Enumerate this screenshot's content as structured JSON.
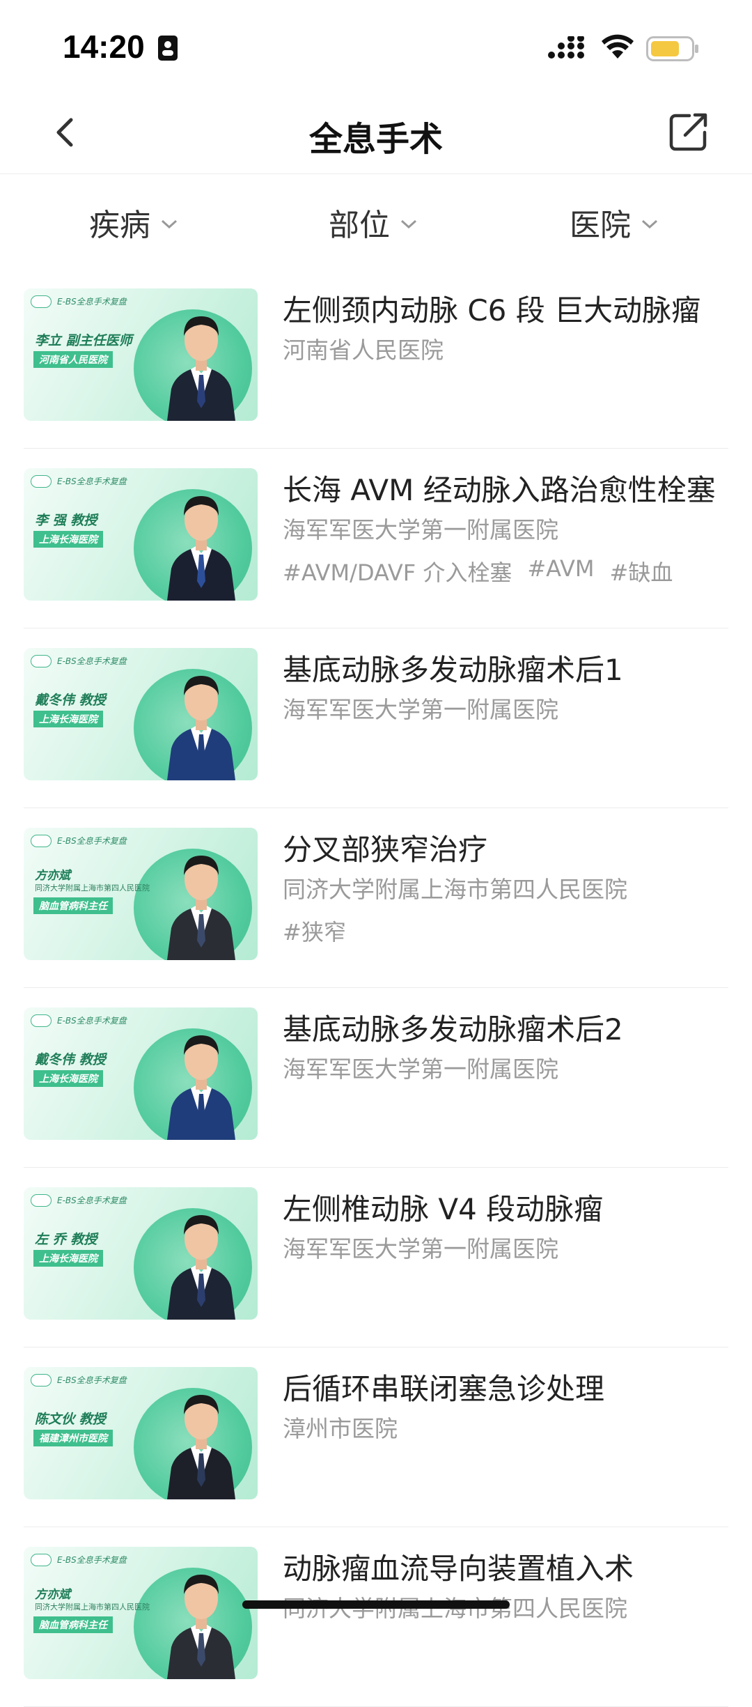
{
  "status_bar": {
    "time": "14:20",
    "icons": [
      "id-card-icon",
      "cellular-signal-icon",
      "wifi-icon",
      "battery-icon"
    ],
    "battery_color": "#f5c842"
  },
  "nav": {
    "title": "全息手术",
    "back_icon": "chevron-left-icon",
    "share_icon": "share-icon"
  },
  "filters": [
    {
      "label": "疾病",
      "icon": "chevron-down-icon"
    },
    {
      "label": "部位",
      "icon": "chevron-down-icon"
    },
    {
      "label": "医院",
      "icon": "chevron-down-icon"
    }
  ],
  "thumbnail_brand": "E-BS全息手术复盘",
  "items": [
    {
      "title": "左侧颈内动脉 C6 段 巨大动脉瘤",
      "hospital": "河南省人民医院",
      "tags": [],
      "thumb": {
        "doctor": "李立  副主任医师",
        "sub": "",
        "badge": "河南省人民医院",
        "suit": "#1d2433",
        "tie": "#2a3f7a"
      }
    },
    {
      "title": "长海 AVM 经动脉入路治愈性栓塞",
      "hospital": "海军军医大学第一附属医院",
      "tags": [
        "#AVM/DAVF 介入栓塞",
        "#AVM",
        "#缺血"
      ],
      "thumb": {
        "doctor": "李  强  教授",
        "sub": "",
        "badge": "上海长海医院",
        "suit": "#1b2030",
        "tie": "#2d4f9a"
      }
    },
    {
      "title": "基底动脉多发动脉瘤术后1",
      "hospital": "海军军医大学第一附属医院",
      "tags": [],
      "thumb": {
        "doctor": "戴冬伟  教授",
        "sub": "",
        "badge": "上海长海医院",
        "suit": "#1f3d7a",
        "tie": "#1f3d7a"
      }
    },
    {
      "title": "分叉部狭窄治疗",
      "hospital": "同济大学附属上海市第四人民医院",
      "tags": [
        "#狭窄"
      ],
      "thumb": {
        "doctor": "方亦斌",
        "sub": "同济大学附属上海市第四人民医院",
        "badge": "脑血管病科主任",
        "suit": "#2a2d34",
        "tie": "#3b4a6a"
      }
    },
    {
      "title": "基底动脉多发动脉瘤术后2",
      "hospital": "海军军医大学第一附属医院",
      "tags": [],
      "thumb": {
        "doctor": "戴冬伟  教授",
        "sub": "",
        "badge": "上海长海医院",
        "suit": "#1f3d7a",
        "tie": "#1f3d7a"
      }
    },
    {
      "title": "左侧椎动脉 V4 段动脉瘤",
      "hospital": "海军军医大学第一附属医院",
      "tags": [],
      "thumb": {
        "doctor": "左  乔  教授",
        "sub": "",
        "badge": "上海长海医院",
        "suit": "#1d2433",
        "tie": "#2c3e6e"
      }
    },
    {
      "title": "后循环串联闭塞急诊处理",
      "hospital": "漳州市医院",
      "tags": [],
      "thumb": {
        "doctor": "陈文伙  教授",
        "sub": "",
        "badge": "福建漳州市医院",
        "suit": "#1d2029",
        "tie": "#2b3a5a"
      }
    },
    {
      "title": "动脉瘤血流导向装置植入术",
      "hospital": "同济大学附属上海市第四人民医院",
      "tags": [],
      "thumb": {
        "doctor": "方亦斌",
        "sub": "同济大学附属上海市第四人民医院",
        "badge": "脑血管病科主任",
        "suit": "#2a2d34",
        "tie": "#3b4a6a"
      }
    }
  ]
}
